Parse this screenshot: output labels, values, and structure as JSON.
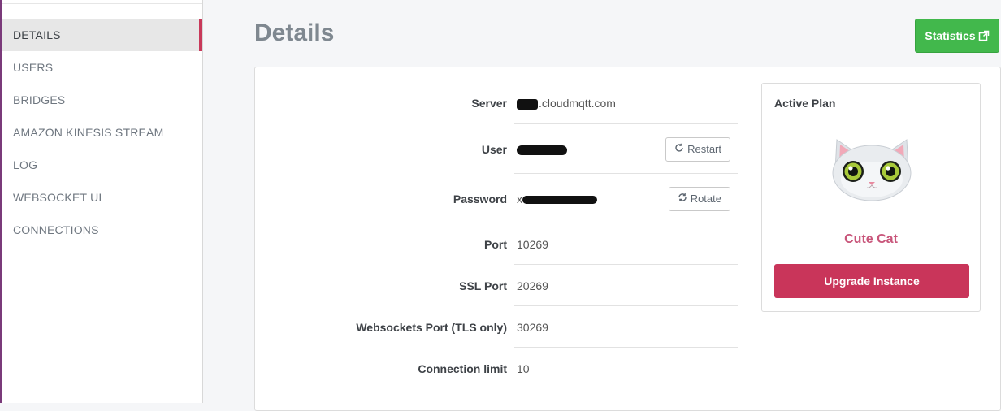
{
  "sidebar": {
    "items": [
      {
        "label": "DETAILS"
      },
      {
        "label": "USERS"
      },
      {
        "label": "BRIDGES"
      },
      {
        "label": "AMAZON KINESIS STREAM"
      },
      {
        "label": "LOG"
      },
      {
        "label": "WEBSOCKET UI"
      },
      {
        "label": "CONNECTIONS"
      }
    ],
    "active": "DETAILS"
  },
  "header": {
    "title": "Details",
    "statistics_label": "Statistics",
    "statistics_icon": "external-link-icon"
  },
  "details": {
    "server": {
      "label": "Server",
      "value": ".cloudmqtt.com"
    },
    "user": {
      "label": "User",
      "value": "",
      "action": "Restart"
    },
    "password": {
      "label": "Password",
      "value": "x",
      "action": "Rotate"
    },
    "port": {
      "label": "Port",
      "value": "10269"
    },
    "ssl_port": {
      "label": "SSL Port",
      "value": "20269"
    },
    "websockets_port": {
      "label": "Websockets Port (TLS only)",
      "value": "30269"
    },
    "connection_limit": {
      "label": "Connection limit",
      "value": "10"
    }
  },
  "plan": {
    "title": "Active Plan",
    "name": "Cute Cat",
    "upgrade_label": "Upgrade Instance",
    "image": "cat-mascot"
  },
  "colors": {
    "accent": "#c9355a",
    "statistics_green": "#42b84c",
    "plan_name": "#c8557a"
  }
}
